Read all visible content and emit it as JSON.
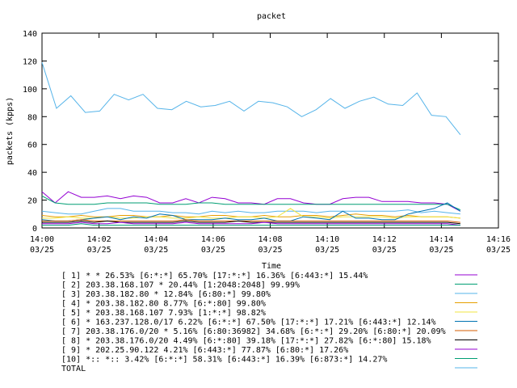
{
  "chart_data": {
    "type": "line",
    "title": "packet",
    "xlabel": "Time",
    "ylabel": "packets (kpps)",
    "ylim": [
      0,
      140
    ],
    "yticks": [
      0,
      20,
      40,
      60,
      80,
      100,
      120,
      140
    ],
    "xlim": [
      "14:00",
      "14:16"
    ],
    "xticks": [
      {
        "time": "14:00",
        "date": "03/25"
      },
      {
        "time": "14:02",
        "date": "03/25"
      },
      {
        "time": "14:04",
        "date": "03/25"
      },
      {
        "time": "14:06",
        "date": "03/25"
      },
      {
        "time": "14:08",
        "date": "03/25"
      },
      {
        "time": "14:10",
        "date": "03/25"
      },
      {
        "time": "14:12",
        "date": "03/25"
      },
      {
        "time": "14:14",
        "date": "03/25"
      },
      {
        "time": "14:16",
        "date": "03/25"
      }
    ],
    "grid": false,
    "legend_position": "bottom",
    "x": [
      "14:00:00",
      "14:00:20",
      "14:00:40",
      "14:01:00",
      "14:01:20",
      "14:01:40",
      "14:02:00",
      "14:02:20",
      "14:02:40",
      "14:03:00",
      "14:03:20",
      "14:03:40",
      "14:04:00",
      "14:04:20",
      "14:04:40",
      "14:05:00",
      "14:05:20",
      "14:05:40",
      "14:06:00",
      "14:06:20",
      "14:06:40",
      "14:07:00",
      "14:07:20",
      "14:07:40",
      "14:08:00",
      "14:08:20",
      "14:08:40",
      "14:09:00",
      "14:09:20",
      "14:09:40",
      "14:10:00",
      "14:10:20",
      "14:10:40",
      "14:11:00",
      "14:11:20",
      "14:11:40",
      "14:12:00",
      "14:12:20",
      "14:12:40",
      "14:13:00",
      "14:13:20",
      "14:13:40",
      "14:14:00",
      "14:14:20",
      "14:14:40"
    ],
    "series": [
      {
        "name": "[ 1] * * 26.53%  [6:*:*] 65.70% [17:*:*] 16.36% [6:443:*] 15.44%",
        "color": "#9400d3",
        "values": [
          26,
          18,
          26,
          22,
          22,
          23,
          21,
          23,
          22,
          18,
          18,
          21,
          18,
          22,
          21,
          18,
          18,
          17,
          21,
          21,
          18,
          17,
          17,
          21,
          22,
          22,
          19,
          19,
          19,
          18,
          18,
          17,
          12
        ]
      },
      {
        "name": "[ 2] 203.38.168.107 * 20.44%  [1:2048:2048] 99.99%",
        "color": "#009e73",
        "values": [
          23,
          18,
          17,
          17,
          17,
          18,
          18,
          18,
          18,
          17,
          17,
          17,
          18,
          18,
          17,
          17,
          17,
          17,
          17,
          17,
          17,
          17,
          17,
          17,
          17,
          17,
          17,
          17,
          17,
          17,
          17,
          17,
          13
        ]
      },
      {
        "name": "[ 3] 203.38.182.80 * 12.84%  [6:80:*] 99.80%",
        "color": "#56b4e9",
        "values": [
          12,
          11,
          10,
          10,
          12,
          14,
          14,
          12,
          12,
          12,
          11,
          11,
          10,
          12,
          11,
          12,
          11,
          11,
          12,
          12,
          12,
          11,
          12,
          12,
          12,
          12,
          12,
          12,
          13,
          11,
          12,
          11,
          10
        ]
      },
      {
        "name": "[ 4] * 203.38.182.80 8.77%  [6:*:80] 99.80%",
        "color": "#e69f00",
        "values": [
          9,
          8,
          8,
          9,
          8,
          8,
          9,
          9,
          8,
          8,
          9,
          8,
          8,
          9,
          9,
          8,
          8,
          9,
          8,
          8,
          9,
          9,
          8,
          9,
          10,
          9,
          9,
          8,
          9,
          8,
          8,
          8,
          7
        ]
      },
      {
        "name": "[ 5] * 203.38.168.107 7.93%  [1:*:*] 98.82%",
        "color": "#f0e442",
        "values": [
          7,
          7,
          8,
          7,
          7,
          8,
          7,
          7,
          8,
          8,
          7,
          7,
          8,
          7,
          7,
          8,
          8,
          7,
          8,
          14,
          8,
          8,
          7,
          8,
          8,
          8,
          8,
          7,
          8,
          8,
          8,
          8,
          7
        ]
      },
      {
        "name": "[ 6] * 163.237.128.0/17 6.22%  [6:*:*] 67.50% [17:*:*] 17.21% [6:443:*] 12.14%",
        "color": "#0072b2",
        "values": [
          6,
          5,
          5,
          6,
          7,
          8,
          6,
          8,
          7,
          10,
          9,
          6,
          6,
          6,
          7,
          6,
          6,
          7,
          5,
          5,
          8,
          7,
          6,
          12,
          7,
          7,
          6,
          6,
          10,
          12,
          14,
          18,
          12
        ]
      },
      {
        "name": "[ 7] 203.38.176.0/20 * 5.16%  [6:80:36982] 34.68% [6:*:*] 29.20% [6:80:*] 20.09%",
        "color": "#d55e00",
        "values": [
          5,
          5,
          5,
          6,
          5,
          5,
          5,
          5,
          5,
          5,
          5,
          6,
          5,
          5,
          5,
          5,
          5,
          5,
          5,
          5,
          5,
          5,
          5,
          5,
          5,
          5,
          5,
          5,
          5,
          5,
          5,
          5,
          4
        ]
      },
      {
        "name": "[ 8] * 203.38.176.0/20 4.49%  [6:*:80] 39.18% [17:*:*] 27.82% [6:*:80] 15.18%",
        "color": "#000000",
        "values": [
          4,
          4,
          4,
          5,
          4,
          5,
          4,
          4,
          4,
          4,
          4,
          5,
          4,
          4,
          4,
          5,
          4,
          4,
          4,
          4,
          4,
          4,
          4,
          4,
          4,
          4,
          4,
          4,
          4,
          4,
          4,
          4,
          3
        ]
      },
      {
        "name": "[ 9] * 202.25.90.122 4.21%  [6:443:*] 77.87% [6:80:*] 17.26%",
        "color": "#9400d3",
        "values": [
          3,
          3,
          3,
          4,
          3,
          3,
          4,
          3,
          3,
          3,
          3,
          4,
          3,
          3,
          3,
          3,
          3,
          4,
          3,
          3,
          3,
          3,
          3,
          3,
          3,
          3,
          3,
          3,
          3,
          3,
          3,
          3,
          2
        ]
      },
      {
        "name": "[10] *:: *:: 3.42%  [6:*:*] 58.31% [6:443:*] 16.39% [6:873:*] 14.27%",
        "color": "#009e73",
        "values": [
          2,
          2,
          2,
          3,
          2,
          2,
          2,
          2,
          2,
          2,
          2,
          2,
          2,
          2,
          2,
          2,
          2,
          2,
          2,
          2,
          2,
          2,
          2,
          2,
          2,
          2,
          2,
          2,
          2,
          2,
          2,
          2,
          2
        ]
      },
      {
        "name": "TOTAL",
        "color": "#56b4e9",
        "values": [
          119,
          86,
          95,
          83,
          84,
          96,
          92,
          96,
          86,
          85,
          91,
          87,
          88,
          91,
          84,
          91,
          90,
          87,
          80,
          85,
          93,
          86,
          91,
          94,
          89,
          88,
          97,
          81,
          80,
          67
        ]
      }
    ]
  }
}
